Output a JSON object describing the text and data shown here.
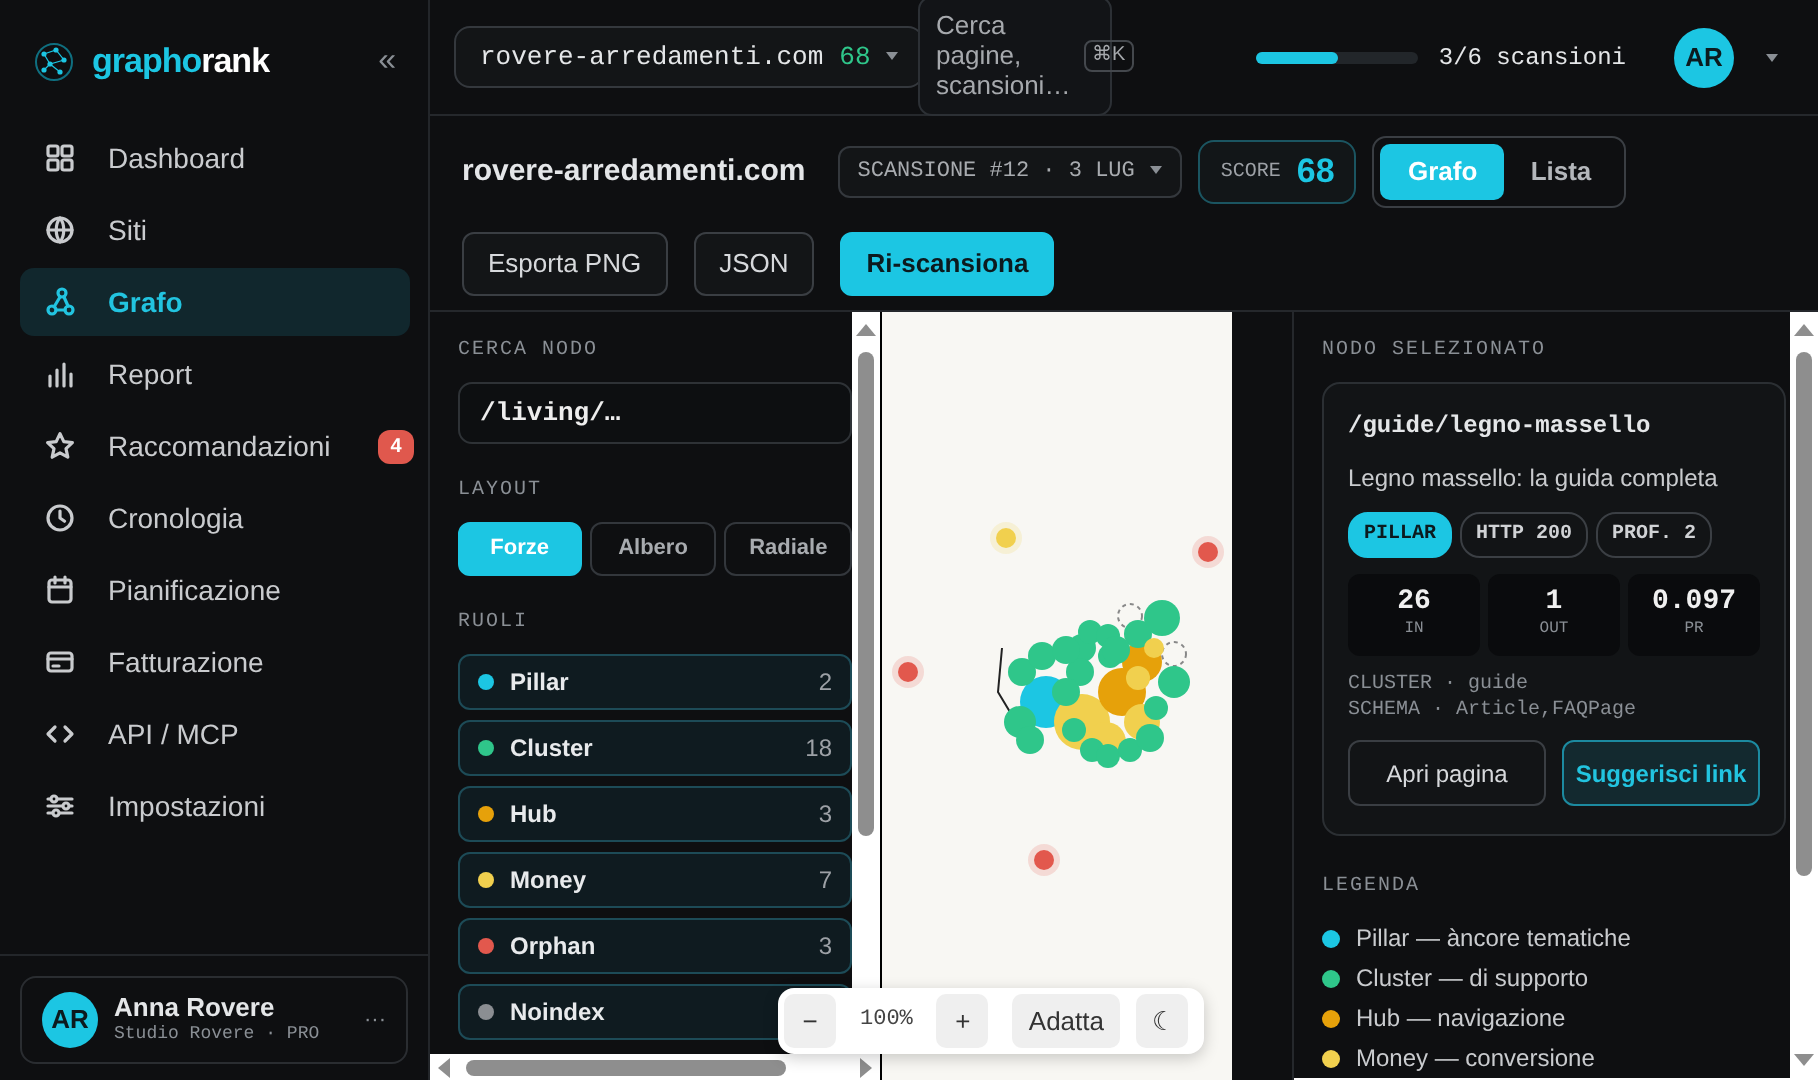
{
  "brand": {
    "name_part_1": "grapho",
    "name_part_2": "rank",
    "collapse_glyph": "«"
  },
  "sidebar": {
    "items": [
      {
        "label": "Dashboard",
        "selected": false
      },
      {
        "label": "Siti",
        "selected": false
      },
      {
        "label": "Grafo",
        "selected": true
      },
      {
        "label": "Report",
        "selected": false
      },
      {
        "label": "Raccomandazioni",
        "selected": false,
        "badge": "4"
      },
      {
        "label": "Cronologia",
        "selected": false
      },
      {
        "label": "Pianificazione",
        "selected": false
      },
      {
        "label": "Fatturazione",
        "selected": false
      },
      {
        "label": "API / MCP",
        "selected": false
      },
      {
        "label": "Impostazioni",
        "selected": false
      }
    ]
  },
  "user": {
    "initials": "AR",
    "name": "Anna Rovere",
    "plan": "Studio Rovere · PRO",
    "more_glyph": "···"
  },
  "topbar": {
    "site_selector": {
      "domain": "rovere-arredamenti.com",
      "score": "68"
    },
    "search": {
      "placeholder": "Cerca pagine, scansioni…",
      "shortcut": "⌘K"
    },
    "quota": {
      "level": 0.5,
      "text": "3/6 scansioni"
    },
    "avatar": "AR"
  },
  "header": {
    "title": "rovere-arredamenti.com",
    "scan_selector": "SCANSIONE #12 · 3 LUG",
    "score_label": "SCORE",
    "score": "68",
    "views": [
      {
        "label": "Grafo",
        "selected": true
      },
      {
        "label": "Lista",
        "selected": false
      }
    ],
    "actions": [
      {
        "label": "Esporta PNG",
        "kind": "outline"
      },
      {
        "label": "JSON",
        "kind": "outline"
      },
      {
        "label": "Ri-scansiona",
        "kind": "primary"
      }
    ]
  },
  "filters": {
    "search_label": "CERCA NODO",
    "search_value": "/living/…",
    "layout_label": "LAYOUT",
    "layouts": [
      {
        "label": "Forze",
        "selected": true
      },
      {
        "label": "Albero",
        "selected": false
      },
      {
        "label": "Radiale",
        "selected": false
      }
    ],
    "roles_label": "RUOLI",
    "roles": [
      {
        "name": "Pillar",
        "count": "2",
        "color": "#1cc6e3"
      },
      {
        "name": "Cluster",
        "count": "18",
        "color": "#2fc68a"
      },
      {
        "name": "Hub",
        "count": "3",
        "color": "#e6a10a"
      },
      {
        "name": "Money",
        "count": "7",
        "color": "#f1d04e"
      },
      {
        "name": "Orphan",
        "count": "3",
        "color": "#e2584d"
      },
      {
        "name": "Noindex",
        "color": "#8b8e92"
      }
    ]
  },
  "zoom": {
    "minus": "−",
    "level": "100%",
    "plus": "+",
    "fit": "Adatta",
    "theme_glyph": "☾"
  },
  "details": {
    "section_label": "NODO SELEZIONATO",
    "path": "/guide/legno-massello",
    "title": "Legno massello: la guida completa",
    "tags": [
      {
        "label": "PILLAR",
        "kind": "role"
      },
      {
        "label": "HTTP 200",
        "kind": "plain"
      },
      {
        "label": "PROF. 2",
        "kind": "plain"
      }
    ],
    "metrics": [
      {
        "value": "26",
        "label": "IN"
      },
      {
        "value": "1",
        "label": "OUT"
      },
      {
        "value": "0.097",
        "label": "PR"
      }
    ],
    "meta": [
      "CLUSTER · guide",
      "SCHEMA · Article,FAQPage"
    ],
    "buttons": [
      {
        "label": "Apri pagina",
        "kind": "outline"
      },
      {
        "label": "Suggerisci link",
        "kind": "accent"
      }
    ]
  },
  "legend": {
    "label": "LEGENDA",
    "items": [
      {
        "text": "Pillar — àncore tematiche",
        "color": "#1cc6e3"
      },
      {
        "text": "Cluster — di supporto",
        "color": "#2fc68a"
      },
      {
        "text": "Hub — navigazione",
        "color": "#e6a10a"
      },
      {
        "text": "Money — conversione",
        "color": "#f1d04e"
      }
    ]
  }
}
